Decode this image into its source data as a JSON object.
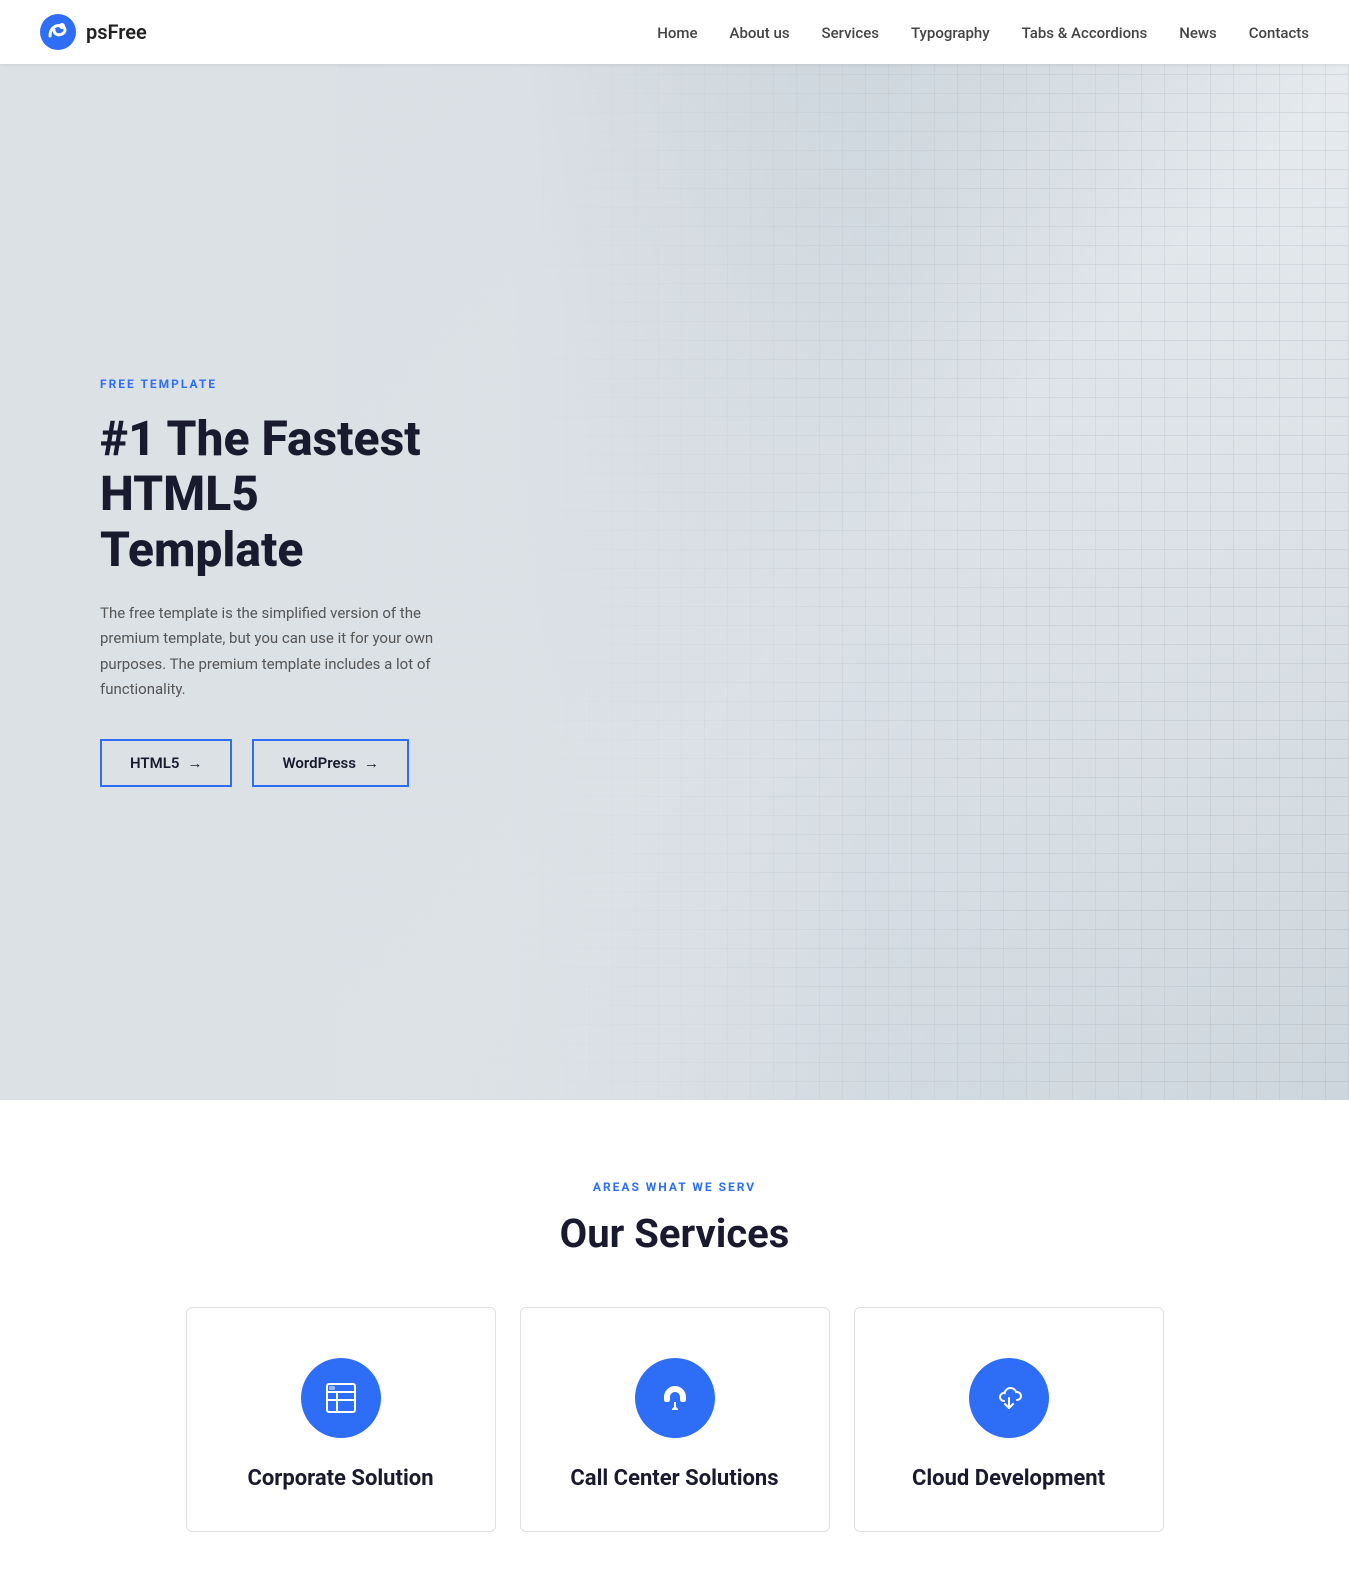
{
  "brand": {
    "name": "psFree"
  },
  "navbar": {
    "items": [
      {
        "label": "Home",
        "href": "#"
      },
      {
        "label": "About us",
        "href": "#"
      },
      {
        "label": "Services",
        "href": "#"
      },
      {
        "label": "Typography",
        "href": "#"
      },
      {
        "label": "Tabs & Accordions",
        "href": "#"
      },
      {
        "label": "News",
        "href": "#"
      },
      {
        "label": "Contacts",
        "href": "#"
      }
    ]
  },
  "hero": {
    "subtitle": "FREE TEMPLATE",
    "title": "#1 The Fastest HTML5 Template",
    "description": "The free template is the simplified version of the premium template, but you can use it for your own purposes. The premium template includes a lot of functionality.",
    "button_html5": "HTML5",
    "button_wordpress": "WordPress"
  },
  "services": {
    "section_label": "AREAS WHAT WE SERV",
    "section_title": "Our Services",
    "cards": [
      {
        "name": "Corporate Solution",
        "icon": "corporate"
      },
      {
        "name": "Call Center Solutions",
        "icon": "callcenter"
      },
      {
        "name": "Cloud Development",
        "icon": "cloud"
      }
    ]
  },
  "colors": {
    "accent": "#2e6ef7"
  }
}
